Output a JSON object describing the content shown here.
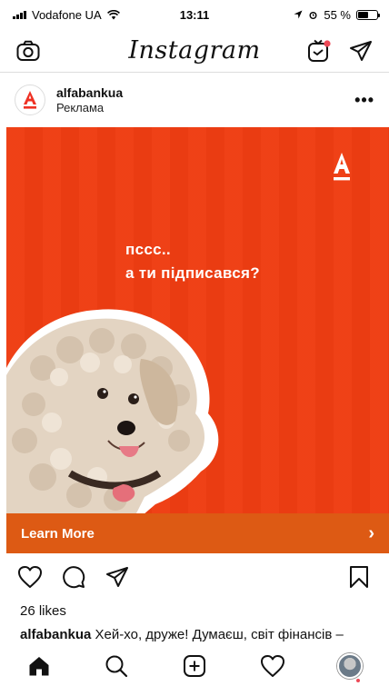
{
  "status_bar": {
    "carrier": "Vodafone UA",
    "time": "13:11",
    "battery_percent": "55 %",
    "battery_level": 0.55
  },
  "nav": {
    "logo": "Instagram"
  },
  "post": {
    "username": "alfabankua",
    "sponsored": "Реклама",
    "more": "•••",
    "ad": {
      "line1": "пссс..",
      "line2": "а ти підписався?",
      "brand_color": "#ef3d12"
    },
    "cta": "Learn More",
    "cta_chevron": "›",
    "likes": "26 likes",
    "caption_user": "alfabankua",
    "caption_text": " Хей-хо, друже! Думаєш, світ фінансів –"
  },
  "icons": {
    "camera": "camera-icon",
    "tv": "igtv-icon",
    "direct": "direct-message-icon",
    "heart": "heart-icon",
    "comment": "comment-icon",
    "share": "share-icon",
    "bookmark": "bookmark-icon",
    "home": "home-icon",
    "search": "search-icon",
    "add": "add-post-icon",
    "activity": "activity-heart-icon",
    "profile": "profile-avatar"
  }
}
